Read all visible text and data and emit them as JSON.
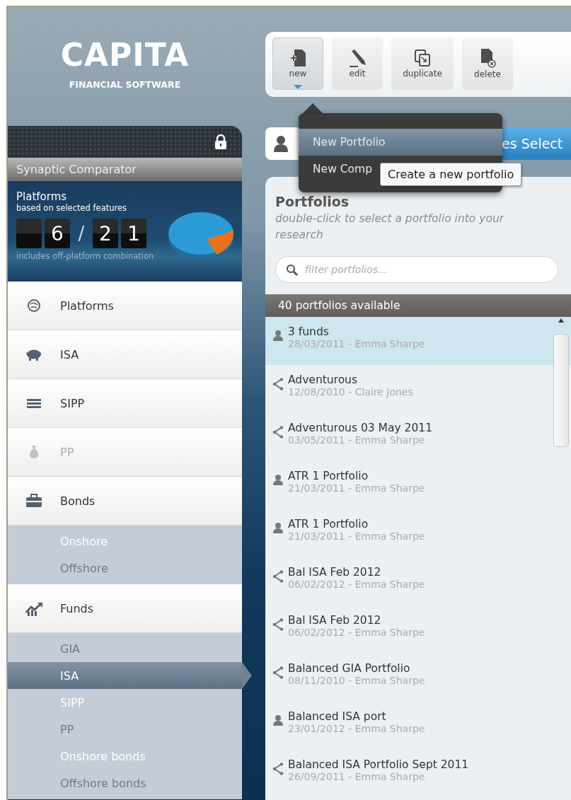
{
  "logo": {
    "name": "CAPITA",
    "tagline": "FINANCIAL SOFTWARE"
  },
  "toolbar": {
    "buttons": [
      {
        "label": "new",
        "selected": true
      },
      {
        "label": "edit",
        "selected": false
      },
      {
        "label": "duplicate",
        "selected": false
      },
      {
        "label": "delete",
        "selected": false
      }
    ]
  },
  "new_menu": {
    "items": [
      {
        "label": "New Portfolio",
        "selected": true
      },
      {
        "label": "New Comp",
        "selected": false
      }
    ],
    "tooltip": "Create a new portfolio"
  },
  "tab_bar": {
    "tab_label": "es Select"
  },
  "sidebar": {
    "title": "Synaptic Comparator",
    "locked": true,
    "summary": {
      "title": "Platforms",
      "subtitle": "based on selected features",
      "count_digits": [
        "6"
      ],
      "separator": "/",
      "total_digits": [
        "2",
        "1"
      ],
      "note": "includes off-platform combination"
    },
    "items": [
      {
        "label": "Platforms",
        "disabled": false
      },
      {
        "label": "ISA",
        "disabled": false
      },
      {
        "label": "SIPP",
        "disabled": false
      },
      {
        "label": "PP",
        "disabled": true
      },
      {
        "label": "Bonds",
        "disabled": false,
        "children": [
          {
            "label": "Onshore",
            "disabled": false,
            "selected": false
          },
          {
            "label": "Offshore",
            "disabled": true,
            "selected": false
          }
        ]
      },
      {
        "label": "Funds",
        "disabled": false,
        "children": [
          {
            "label": "GIA",
            "disabled": true,
            "selected": false
          },
          {
            "label": "ISA",
            "disabled": false,
            "selected": true
          },
          {
            "label": "SIPP",
            "disabled": false,
            "selected": false
          },
          {
            "label": "PP",
            "disabled": true,
            "selected": false
          },
          {
            "label": "Onshore bonds",
            "disabled": false,
            "selected": false
          },
          {
            "label": "Offshore bonds",
            "disabled": true,
            "selected": false
          }
        ]
      }
    ]
  },
  "portfolios": {
    "title": "Portfolios",
    "hint": "double-click to select a portfolio into your research",
    "filter": {
      "placeholder": "filter portfolios..."
    },
    "count": "40 portfolios available",
    "rows": [
      {
        "kind": "own",
        "name": "3 funds",
        "meta": "28/03/2011 - Emma Sharpe",
        "selected": true
      },
      {
        "kind": "shared",
        "name": "Adventurous",
        "meta": "12/08/2010 - Claire Jones",
        "selected": false
      },
      {
        "kind": "shared",
        "name": "Adventurous 03 May 2011",
        "meta": "03/05/2011 - Emma Sharpe",
        "selected": false
      },
      {
        "kind": "own",
        "name": "ATR 1 Portfolio",
        "meta": "21/03/2011 - Emma Sharpe",
        "selected": false
      },
      {
        "kind": "own",
        "name": "ATR 1 Portfolio",
        "meta": "21/03/2011 - Emma Sharpe",
        "selected": false
      },
      {
        "kind": "shared",
        "name": "Bal ISA Feb 2012",
        "meta": "06/02/2012 - Emma Sharpe",
        "selected": false
      },
      {
        "kind": "shared",
        "name": "Bal ISA Feb 2012",
        "meta": "06/02/2012 - Emma Sharpe",
        "selected": false
      },
      {
        "kind": "shared",
        "name": "Balanced GIA Portfolio",
        "meta": "08/11/2010 - Emma Sharpe",
        "selected": false
      },
      {
        "kind": "own",
        "name": "Balanced ISA port",
        "meta": "23/01/2012 - Emma Sharpe",
        "selected": false
      },
      {
        "kind": "shared",
        "name": "Balanced ISA Portfolio Sept 2011",
        "meta": "26/09/2011 - Emma Sharpe",
        "selected": false
      }
    ]
  }
}
